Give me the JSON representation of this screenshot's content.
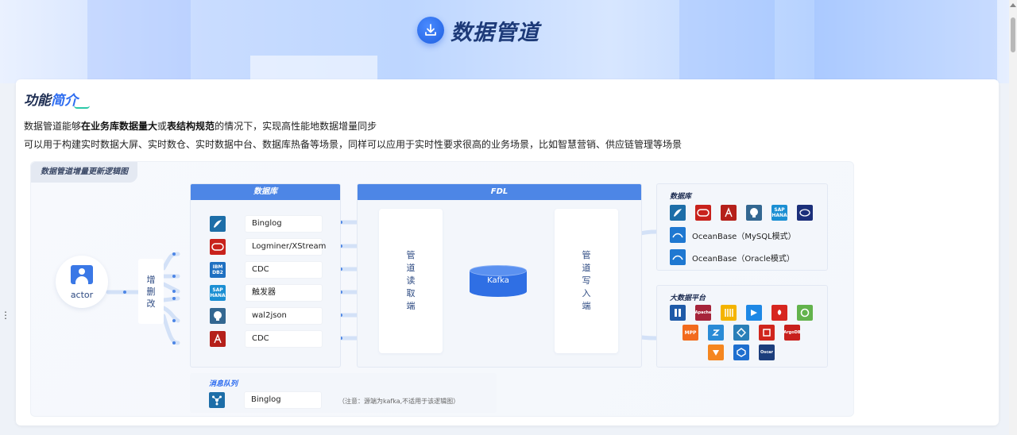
{
  "header": {
    "title": "数据管道",
    "icon": "download-icon"
  },
  "intro": {
    "section_title_part1": "功能",
    "section_title_part2": "简介",
    "line1_prefix": "数据管道能够",
    "line1_bold1": "在业务库数据量大",
    "line1_mid": "或",
    "line1_bold2": "表结构规范",
    "line1_suffix": "的情况下，实现高性能地数据增量同步",
    "line2": "可以用于构建实时数据大屏、实时数仓、实时数据中台、数据库热备等场景，同样可以应用于实时性要求很高的业务场景，比如智慧营销、供应链管理等场景"
  },
  "diagram": {
    "tag": "数据管道增量更新逻辑图",
    "actor_label": "actor",
    "crud": [
      "增",
      "删",
      "改"
    ],
    "source_panel_title": "数据库",
    "sources": [
      {
        "label": "Binglog",
        "icon": "mysql-icon",
        "color": "#1d6ea8"
      },
      {
        "label": "Logminer/XStream",
        "icon": "oracle-icon",
        "color": "#c8221c"
      },
      {
        "label": "CDC",
        "icon": "ibm-db2-icon",
        "color": "#1f70c1"
      },
      {
        "label": "触发器",
        "icon": "sap-hana-icon",
        "color": "#1b8fd3"
      },
      {
        "label": "wal2json",
        "icon": "postgresql-icon",
        "color": "#336791"
      },
      {
        "label": "CDC",
        "icon": "sqlserver-icon",
        "color": "#b5201a"
      }
    ],
    "fdl_title": "FDL",
    "pipe_reader": [
      "管",
      "道",
      "读",
      "取",
      "端"
    ],
    "pipe_writer": [
      "管",
      "道",
      "写",
      "入",
      "端"
    ],
    "kafka_label": "Kafka",
    "target_db": {
      "title": "数据库",
      "icons": [
        {
          "icon": "mysql-icon",
          "color": "#1d6ea8"
        },
        {
          "icon": "oracle-icon",
          "color": "#c8221c"
        },
        {
          "icon": "sqlserver-icon",
          "color": "#b5201a"
        },
        {
          "icon": "postgresql-icon",
          "color": "#336791"
        },
        {
          "icon": "sap-hana-icon",
          "color": "#1b8fd3"
        },
        {
          "icon": "db2-icon",
          "color": "#1b2f7a"
        }
      ],
      "oceanbase_mysql": "OceanBase（MySQL模式）",
      "oceanbase_oracle": "OceanBase（Oracle模式）"
    },
    "bigdata": {
      "title": "大数据平台",
      "icons": [
        {
          "icon": "hadoop-icon",
          "color": "#1e5aa8"
        },
        {
          "icon": "apache-icon",
          "color": "#a6243a"
        },
        {
          "icon": "impala-icon",
          "color": "#f4b400"
        },
        {
          "icon": "starrocks-icon",
          "color": "#1e88e5"
        },
        {
          "icon": "huawei-icon",
          "color": "#d7261f"
        },
        {
          "icon": "greenplum-icon",
          "color": "#63b34c"
        },
        {
          "icon": "gbase-mpp-icon",
          "color": "#f26b1d"
        },
        {
          "icon": "doris-icon",
          "color": "#2a8bd6"
        },
        {
          "icon": "selectdb-icon",
          "color": "#2a7fb8"
        },
        {
          "icon": "tdsql-icon",
          "color": "#d0261d"
        },
        {
          "icon": "argodb-icon",
          "color": "#c8201d"
        },
        {
          "icon": "hive-icon",
          "color": "#f5861f"
        },
        {
          "icon": "clickhouse-icon",
          "color": "#1e6fcf"
        },
        {
          "icon": "oscar-icon",
          "color": "#1c3e7c"
        }
      ],
      "gbase_label": "MPP",
      "argodb_label": "ArgoDB",
      "oscar_label": "Oscar"
    },
    "mq": {
      "title": "消息队列",
      "source_label": "Binglog",
      "icon": "kafka-icon",
      "note": "（注意：源端为kafka,不适用于该逻辑图）"
    }
  },
  "colors": {
    "accent": "#2d6cf0",
    "panel_head": "#4d86e6",
    "kafka": "#2f6fe4"
  }
}
